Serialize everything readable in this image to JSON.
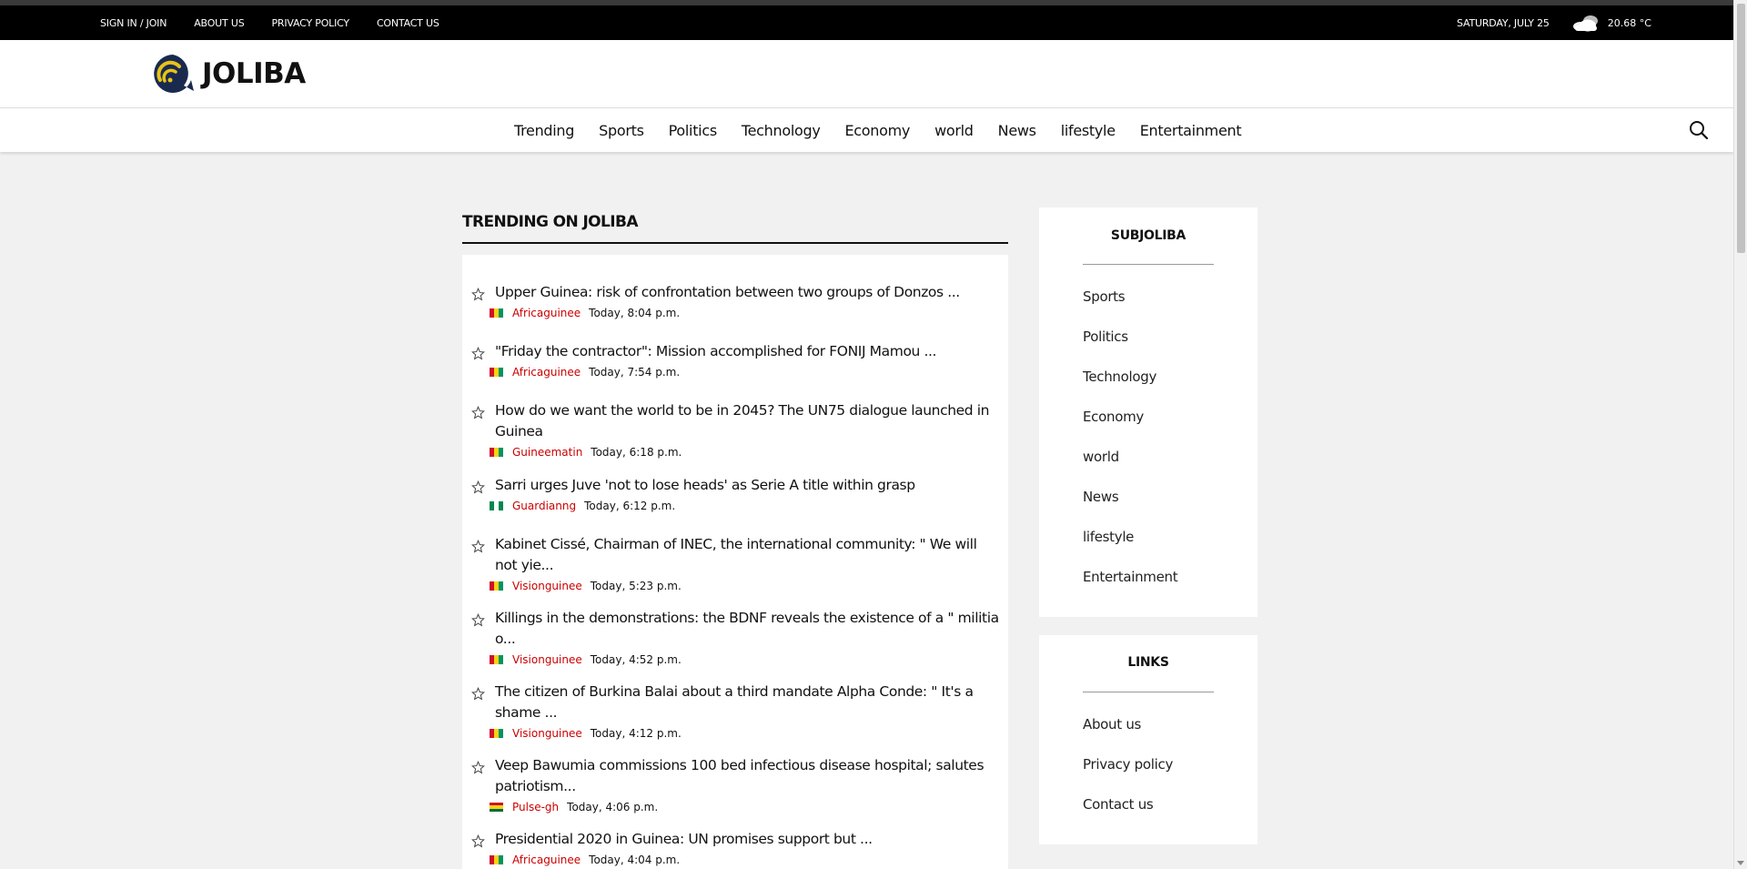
{
  "topbar": {
    "links": [
      "SIGN IN / JOIN",
      "ABOUT US",
      "PRIVACY POLICY",
      "CONTACT US"
    ],
    "date": "SATURDAY, JULY 25",
    "weather_icon": "cloud-icon",
    "temperature": "20.68 °C"
  },
  "brand": {
    "name": "JOLIBA",
    "logo_icon": "joliba-logo-icon"
  },
  "nav": {
    "items": [
      "Trending",
      "Sports",
      "Politics",
      "Technology",
      "Economy",
      "world",
      "News",
      "lifestyle",
      "Entertainment"
    ],
    "search_icon": "search-icon"
  },
  "trending": {
    "title": "TRENDING ON JOLIBA",
    "items": [
      {
        "title": "Upper Guinea: risk of confrontation between two groups of Donzos ...",
        "source": "Africaguinee",
        "time": "Today, 8:04 p.m.",
        "flag": "guinea"
      },
      {
        "title": "\"Friday the contractor\": Mission accomplished for FONIJ Mamou ...",
        "source": "Africaguinee",
        "time": "Today, 7:54 p.m.",
        "flag": "guinea"
      },
      {
        "title": "How do we want the world to be in 2045? The UN75 dialogue launched in Guinea",
        "source": "Guineematin",
        "time": "Today, 6:18 p.m.",
        "flag": "guinea"
      },
      {
        "title": "Sarri urges Juve 'not to lose heads' as Serie A title within grasp",
        "source": "Guardianng",
        "time": "Today, 6:12 p.m.",
        "flag": "nigeria"
      },
      {
        "title": "Kabinet Cissé, Chairman of INEC, the international community: \" We will not yie...",
        "source": "Visionguinee",
        "time": "Today, 5:23 p.m.",
        "flag": "guinea"
      },
      {
        "title": "Killings in the demonstrations: the BDNF reveals the existence of a \" militia o...",
        "source": "Visionguinee",
        "time": "Today, 4:52 p.m.",
        "flag": "guinea"
      },
      {
        "title": "The citizen of Burkina Balai about a third mandate Alpha Conde: \" It's a shame ...",
        "source": "Visionguinee",
        "time": "Today, 4:12 p.m.",
        "flag": "guinea"
      },
      {
        "title": "Veep Bawumia commissions 100 bed infectious disease hospital; salutes patriotism...",
        "source": "Pulse-gh",
        "time": "Today, 4:06 p.m.",
        "flag": "ghana"
      },
      {
        "title": "Presidential 2020 in Guinea: UN promises support but ...",
        "source": "Africaguinee",
        "time": "Today, 4:04 p.m.",
        "flag": "guinea"
      }
    ]
  },
  "subjoliba": {
    "title": "SUBJOLIBA",
    "links": [
      "Sports",
      "Politics",
      "Technology",
      "Economy",
      "world",
      "News",
      "lifestyle",
      "Entertainment"
    ]
  },
  "links_widget": {
    "title": "LINKS",
    "links": [
      "About us",
      "Privacy policy",
      "Contact us"
    ]
  },
  "colors": {
    "source_red": "#cc0000",
    "topbar_bg": "#000000",
    "page_bg": "#f1f1f1"
  }
}
